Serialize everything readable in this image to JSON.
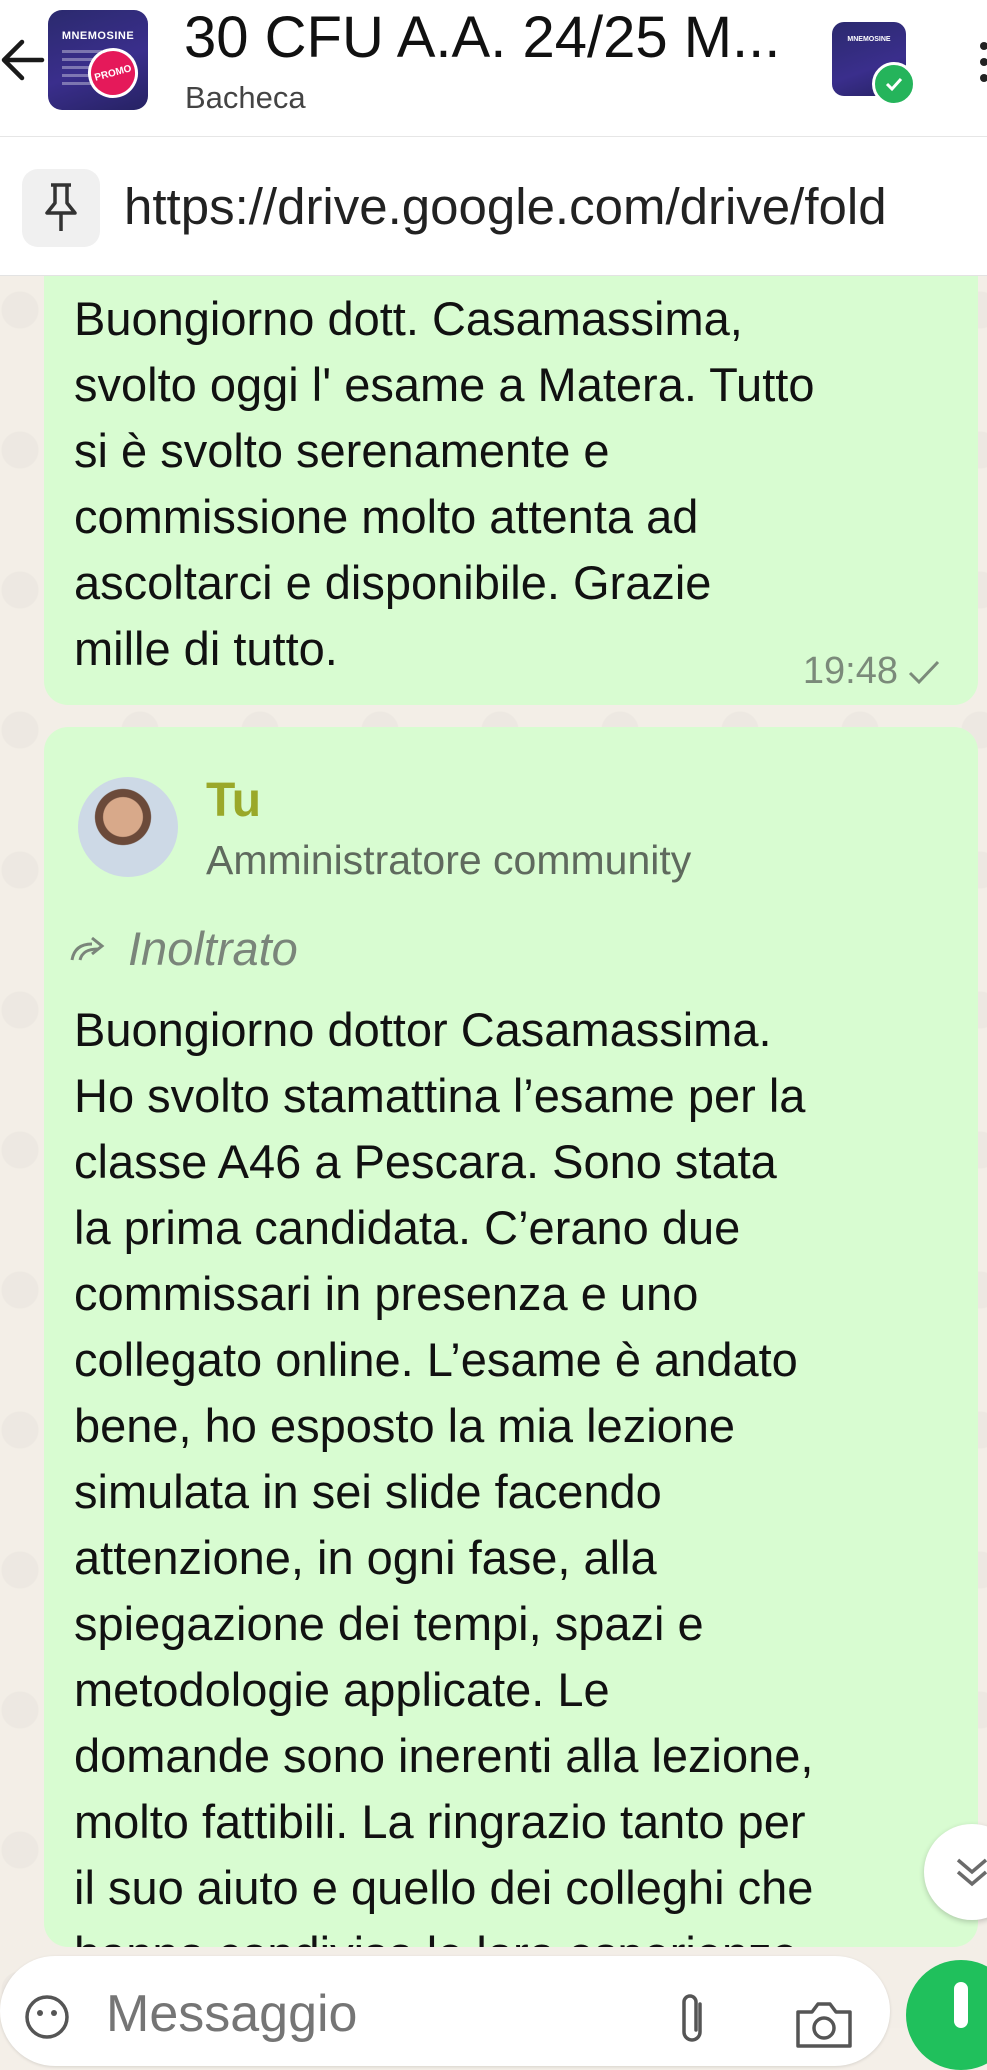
{
  "header": {
    "title": "30 CFU A.A. 24/25 M...",
    "subtitle": "Bacheca",
    "group_avatar_title": "MNEMOSINE",
    "group_avatar_badge": "PROMO",
    "community_avatar_title": "MNEMOSINE"
  },
  "pinned": {
    "text": "https://drive.google.com/drive/fold"
  },
  "messages": [
    {
      "text": "Buongiorno dott. Casamassima,\nsvolto oggi l' esame a Matera. Tutto\nsi è svolto serenamente e\ncommissione molto attenta ad\nascoltarci e disponibile.  Grazie\nmille di tutto.",
      "time": "19:48"
    },
    {
      "sender": "Tu",
      "role": "Amministratore community",
      "forwarded_label": "Inoltrato",
      "text": "Buongiorno dottor Casamassima.\nHo svolto stamattina l’esame per la\nclasse A46 a Pescara. Sono stata\nla prima candidata. C’erano due\ncommissari in presenza e uno\ncollegato online. L’esame è andato\nbene, ho esposto la mia lezione\nsimulata in sei slide facendo\nattenzione, in ogni fase, alla\nspiegazione dei tempi, spazi e\nmetodologie applicate. Le\ndomande sono inerenti alla lezione,\nmolto fattibili. La ringrazio tanto per\nil suo aiuto e quello dei colleghi che\nhanno condiviso le loro esperienze"
    }
  ],
  "composer": {
    "placeholder": "Messaggio"
  },
  "colors": {
    "bubble": "#d8fcd1",
    "sender_name": "#9aa82a",
    "mic": "#20c05c",
    "verified": "#25b45b"
  }
}
